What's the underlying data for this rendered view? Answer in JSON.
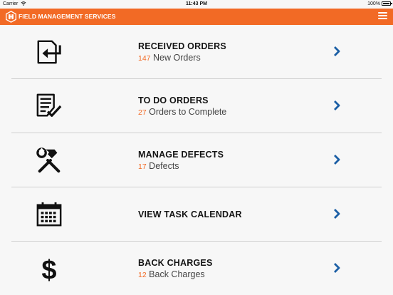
{
  "status_bar": {
    "carrier": "Carrier",
    "time": "11:43 PM",
    "battery": "100%"
  },
  "header": {
    "title": "FIELD MANAGEMENT SERVICES",
    "menu_icon": "hamburger-menu-icon",
    "logo_icon": "fms-logo-icon"
  },
  "colors": {
    "accent": "#f26a25",
    "chevron": "#1c5fa5",
    "text": "#141414"
  },
  "menu_items": [
    {
      "title": "RECEIVED ORDERS",
      "count": "147",
      "label": "New Orders",
      "icon": "received-orders-icon"
    },
    {
      "title": "TO DO ORDERS",
      "count": "27",
      "label": "Orders to Complete",
      "icon": "todo-orders-icon"
    },
    {
      "title": "MANAGE DEFECTS",
      "count": "17",
      "label": "Defects",
      "icon": "tools-icon"
    },
    {
      "title": "VIEW TASK CALENDAR",
      "count": "",
      "label": "",
      "icon": "calendar-icon"
    },
    {
      "title": "BACK CHARGES",
      "count": "12",
      "label": "Back Charges",
      "icon": "dollar-icon"
    }
  ]
}
